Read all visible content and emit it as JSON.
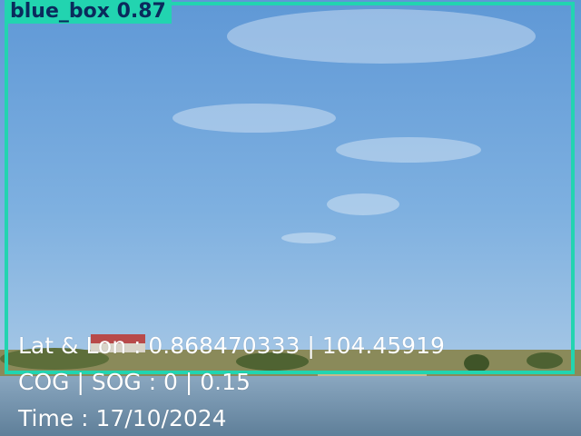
{
  "detection": {
    "label": "blue_box 0.87",
    "color": "#22d4b0"
  },
  "telemetry": {
    "latlon": "Lat & Lon : 0.868470333 | 104.45919",
    "cog_sog": "COG | SOG : 0 | 0.15",
    "time": "Time : 17/10/2024"
  }
}
